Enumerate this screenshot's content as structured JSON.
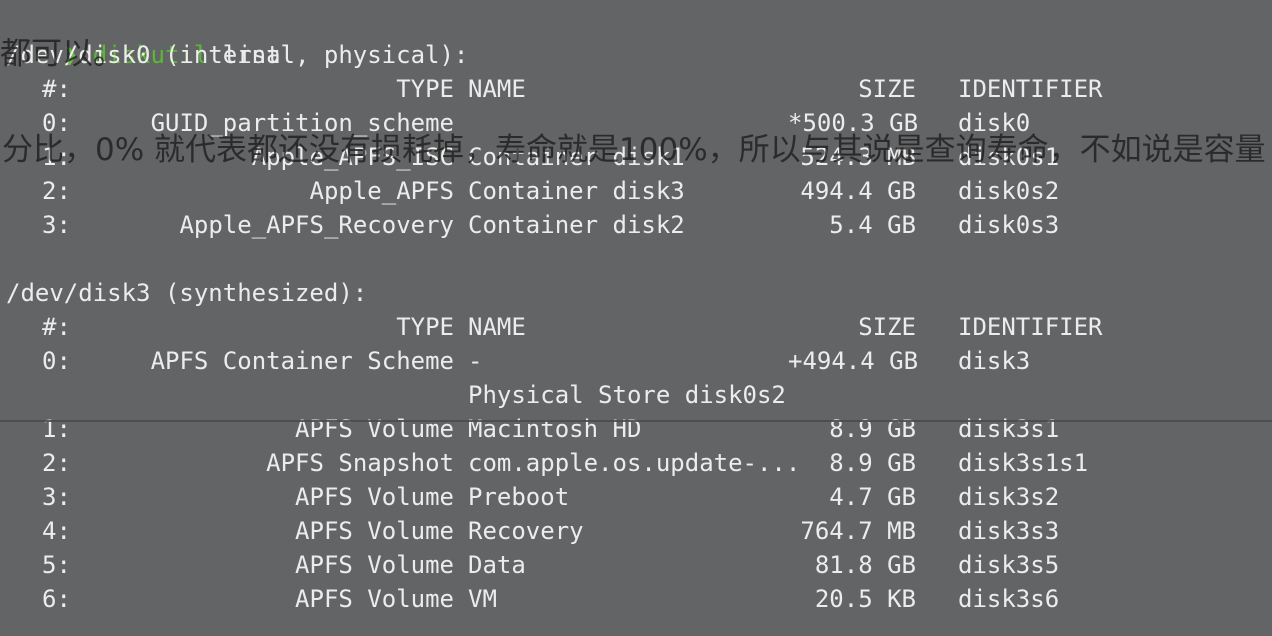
{
  "colors": {
    "background": "#636466",
    "text": "#ececec",
    "prompt": "#59b935"
  },
  "prompt": {
    "arrow": "❯",
    "command": "diskutil",
    "argument": "list"
  },
  "overlay": {
    "top_fragment": "都可以。",
    "middle_line": "分比，0% 就代表都还没有损耗掉，寿命就是100%，所以与其说是查询寿命，不如说是容量"
  },
  "disk0": {
    "header": "/dev/disk0 (internal, physical):",
    "columns": {
      "num": "#:",
      "type": "TYPE",
      "name": "NAME",
      "size": "SIZE",
      "identifier": "IDENTIFIER"
    },
    "rows": [
      {
        "num": "0:",
        "type": "GUID_partition_scheme",
        "name": "",
        "size": "*500.3 GB",
        "identifier": "disk0"
      },
      {
        "num": "1:",
        "type": "Apple_APFS_ISC",
        "name": "Container disk1",
        "size": "524.3 MB",
        "identifier": "disk0s1"
      },
      {
        "num": "2:",
        "type": "Apple_APFS",
        "name": "Container disk3",
        "size": "494.4 GB",
        "identifier": "disk0s2"
      },
      {
        "num": "3:",
        "type": "Apple_APFS_Recovery",
        "name": "Container disk2",
        "size": "5.4 GB",
        "identifier": "disk0s3"
      }
    ]
  },
  "disk3": {
    "header": "/dev/disk3 (synthesized):",
    "columns": {
      "num": "#:",
      "type": "TYPE",
      "name": "NAME",
      "size": "SIZE",
      "identifier": "IDENTIFIER"
    },
    "rows": [
      {
        "num": "0:",
        "type": "APFS Container Scheme",
        "name": "-",
        "size": "+494.4 GB",
        "identifier": "disk3"
      },
      {
        "num": "",
        "type": "",
        "name": "Physical Store disk0s2",
        "size": "",
        "identifier": ""
      },
      {
        "num": "1:",
        "type": "APFS Volume",
        "name": "Macintosh HD",
        "size": "8.9 GB",
        "identifier": "disk3s1"
      },
      {
        "num": "2:",
        "type": "APFS Snapshot",
        "name": "com.apple.os.update-...",
        "size": "8.9 GB",
        "identifier": "disk3s1s1"
      },
      {
        "num": "3:",
        "type": "APFS Volume",
        "name": "Preboot",
        "size": "4.7 GB",
        "identifier": "disk3s2"
      },
      {
        "num": "4:",
        "type": "APFS Volume",
        "name": "Recovery",
        "size": "764.7 MB",
        "identifier": "disk3s3"
      },
      {
        "num": "5:",
        "type": "APFS Volume",
        "name": "Data",
        "size": "81.8 GB",
        "identifier": "disk3s5"
      },
      {
        "num": "6:",
        "type": "APFS Volume",
        "name": "VM",
        "size": "20.5 KB",
        "identifier": "disk3s6"
      }
    ]
  }
}
